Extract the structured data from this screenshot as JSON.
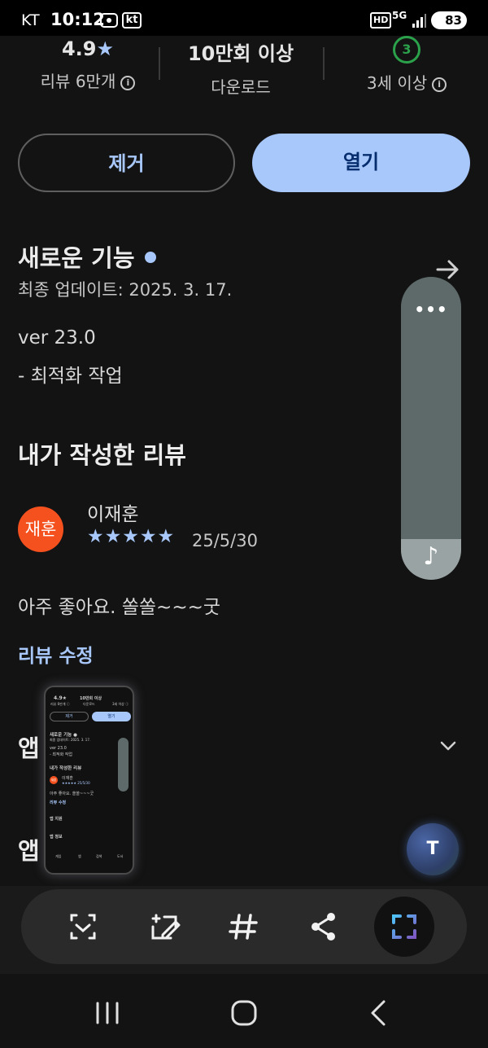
{
  "status_bar": {
    "carrier": "KT",
    "time": "10:12",
    "kt_badge": "kt",
    "hd": "HD",
    "network": "5G",
    "battery": "83"
  },
  "stats": {
    "rating": "4.9",
    "rating_star": "★",
    "reviews": "리뷰 6만개",
    "downloads": "10만회 이상",
    "downloads_label": "다운로드",
    "age_badge": "3",
    "age_label": "3세 이상",
    "info_icon": "i"
  },
  "actions": {
    "remove_label": "제거",
    "open_label": "열기"
  },
  "whats_new": {
    "title": "새로운 기능",
    "updated": "최종 업데이트: 2025. 3. 17.",
    "version": "ver 23.0",
    "note": "- 최적화 작업"
  },
  "my_review": {
    "title": "내가 작성한 리뷰",
    "avatar_text": "재훈",
    "author": "이재훈",
    "stars": "★★★★★",
    "rating": 5,
    "date": "25/5/30",
    "text": "아주 좋아요. 쏠쏠~~~굿",
    "edit_link": "리뷰 수정"
  },
  "sections": {
    "app_support_partial": "앱",
    "app_info_partial": "앱"
  },
  "side_panel": {
    "more_label": "•••",
    "music_icon": "♪"
  },
  "thumbnail": {
    "rating": "4.9★",
    "reviews": "리뷰 6만개 ⓘ",
    "downloads": "10만회 이상",
    "downloads_label": "다운로드",
    "age_label": "3세 이상 ⓘ",
    "remove": "제거",
    "open": "열기",
    "whats_new": "새로운 기능 ●",
    "updated": "최종 업데이트: 2025. 3. 17.",
    "version": "ver 23.0",
    "note": "- 최적화 작업",
    "review_title": "내가 작성한 리뷰",
    "avatar": "재훈",
    "author": "이재훈",
    "stars_date": "★★★★★  25/5/30",
    "review_text": "아주 좋아요. 쏠쏠~~~굿",
    "edit": "리뷰 수정",
    "app_support": "앱 지원",
    "app_info": "앱 정보",
    "nav": [
      "게임",
      "앱",
      "검색",
      "도서"
    ]
  },
  "fab": {
    "text_icon": "T"
  },
  "toolbar_icons": [
    "scan-select-icon",
    "edit-image-icon",
    "hashtag-icon",
    "share-icon",
    "capture-icon"
  ],
  "colors": {
    "background": "#131313",
    "accent": "#a8c7fa",
    "avatar": "#f4511e",
    "age_badge": "#2aa14a"
  }
}
